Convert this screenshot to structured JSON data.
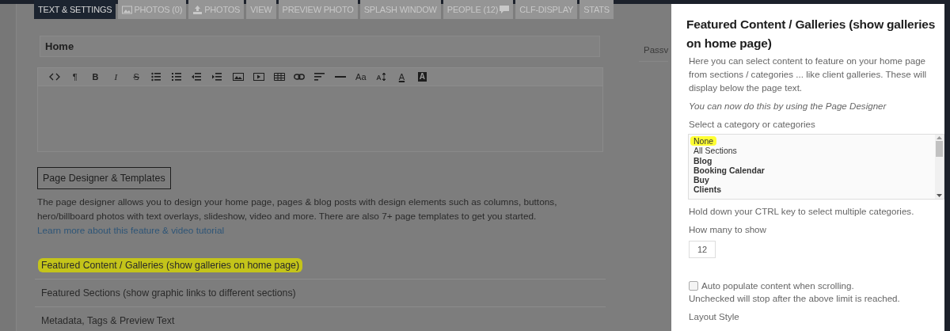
{
  "tabs": [
    {
      "label": "TEXT & SETTINGS",
      "selected": true,
      "kind": "text"
    },
    {
      "label": "PHOTOS (0)",
      "selected": false,
      "kind": "image"
    },
    {
      "label": "PHOTOS",
      "selected": false,
      "kind": "upload"
    },
    {
      "label": "VIEW",
      "selected": false,
      "kind": "text"
    },
    {
      "label": "PREVIEW PHOTO",
      "selected": false,
      "kind": "text"
    },
    {
      "label": "SPLASH WINDOW",
      "selected": false,
      "kind": "text"
    },
    {
      "label": "PEOPLE (12)",
      "selected": false,
      "kind": "chat"
    },
    {
      "label": "CLF-DISPLAY",
      "selected": false,
      "kind": "text"
    },
    {
      "label": "STATS",
      "selected": false,
      "kind": "text"
    }
  ],
  "title_field": {
    "value": "Home"
  },
  "toolbar": [
    {
      "kind": "code"
    },
    {
      "kind": "glyph",
      "glyph": "¶"
    },
    {
      "kind": "bold",
      "glyph": "B"
    },
    {
      "kind": "italic",
      "glyph": "I"
    },
    {
      "kind": "strike",
      "glyph": "S"
    },
    {
      "kind": "bullets"
    },
    {
      "kind": "numbers"
    },
    {
      "kind": "outdent"
    },
    {
      "kind": "indent"
    },
    {
      "kind": "image"
    },
    {
      "kind": "video"
    },
    {
      "kind": "table"
    },
    {
      "kind": "link"
    },
    {
      "kind": "align"
    },
    {
      "kind": "rule"
    },
    {
      "kind": "glyph",
      "glyph": "Aa"
    },
    {
      "kind": "size"
    },
    {
      "kind": "color",
      "glyph": "A"
    },
    {
      "kind": "background",
      "glyph": "A"
    }
  ],
  "designer_button": "Page Designer & Templates",
  "designer_text": "The page designer allows you to design your home page, pages & blog posts with design elements such as columns, buttons, hero/billboard photos with text overlays, slideshow, video and more. There are also 7+ page templates to get you started.",
  "designer_link": "Learn more about this feature & video tutorial",
  "sections": [
    {
      "label": "Featured Content / Galleries (show galleries on home page)",
      "highlighted": true
    },
    {
      "label": "Featured Sections (show graphic links to different sections)",
      "highlighted": false
    },
    {
      "label": "Metadata, Tags & Preview Text",
      "highlighted": false
    }
  ],
  "side_label": "Passv",
  "panel": {
    "title": "Featured Content / Galleries (show galleries on home page)",
    "description": "Here you can select content to feature on your home page from sections / categories ... like client galleries. These will display below the page text.",
    "note": "You can now do this by using the Page Designer",
    "select_label": "Select a category or categories",
    "options": [
      {
        "label": "None",
        "kind": "item",
        "highlighted": true
      },
      {
        "label": "All Sections",
        "kind": "item",
        "highlighted": false
      },
      {
        "label": "Blog",
        "kind": "heading",
        "highlighted": false
      },
      {
        "label": "Booking Calendar",
        "kind": "heading",
        "highlighted": false
      },
      {
        "label": "Buy",
        "kind": "heading",
        "highlighted": false
      },
      {
        "label": "Clients",
        "kind": "heading",
        "highlighted": false
      }
    ],
    "select_hint": "Hold down your CTRL key to select multiple categories.",
    "count_label": "How many to show",
    "count_value": "12",
    "auto_populate": {
      "label": "Auto populate content when scrolling.",
      "checked": false
    },
    "auto_hint": "Unchecked will stop after the above limit is reached.",
    "layout_label": "Layout Style"
  }
}
